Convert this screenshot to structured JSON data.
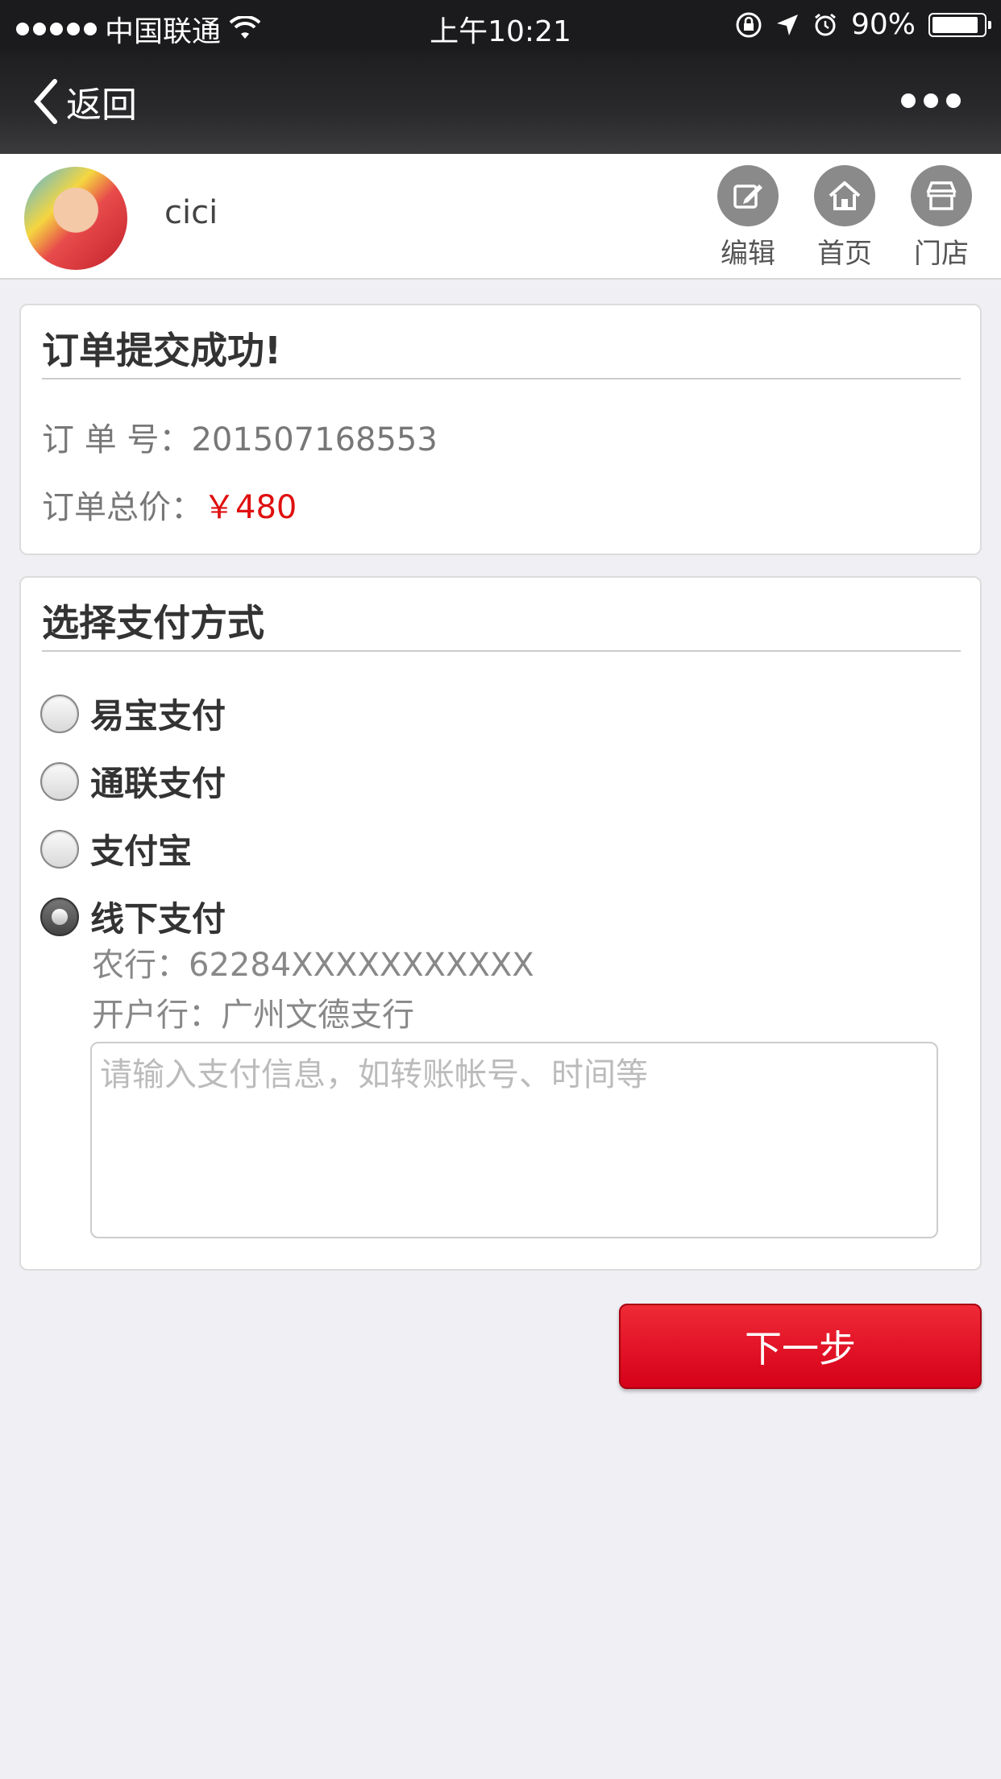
{
  "status_bar": {
    "carrier": "中国联通",
    "time": "上午10:21",
    "battery": "90%",
    "battery_level": 0.9
  },
  "nav": {
    "back_label": "返回"
  },
  "user": {
    "name": "cici",
    "tools": [
      {
        "label": "编辑",
        "icon": "edit-icon"
      },
      {
        "label": "首页",
        "icon": "home-icon"
      },
      {
        "label": "门店",
        "icon": "store-icon"
      }
    ]
  },
  "order": {
    "title": "订单提交成功!",
    "number_label": "订 单 号：",
    "number": "201507168553",
    "total_label": "订单总价：",
    "total": "￥480"
  },
  "payment": {
    "title": "选择支付方式",
    "options": [
      {
        "label": "易宝支付",
        "checked": false
      },
      {
        "label": "通联支付",
        "checked": false
      },
      {
        "label": "支付宝",
        "checked": false
      },
      {
        "label": "线下支付",
        "checked": true
      }
    ],
    "bank_line": "农行：62284XXXXXXXXXXX",
    "branch_line": "开户行：广州文德支行",
    "input_placeholder": "请输入支付信息，如转账帐号、时间等"
  },
  "next_button": "下一步",
  "colors": {
    "accent": "#d6001a",
    "price": "#e01010",
    "navbar": "#1e1e20"
  }
}
